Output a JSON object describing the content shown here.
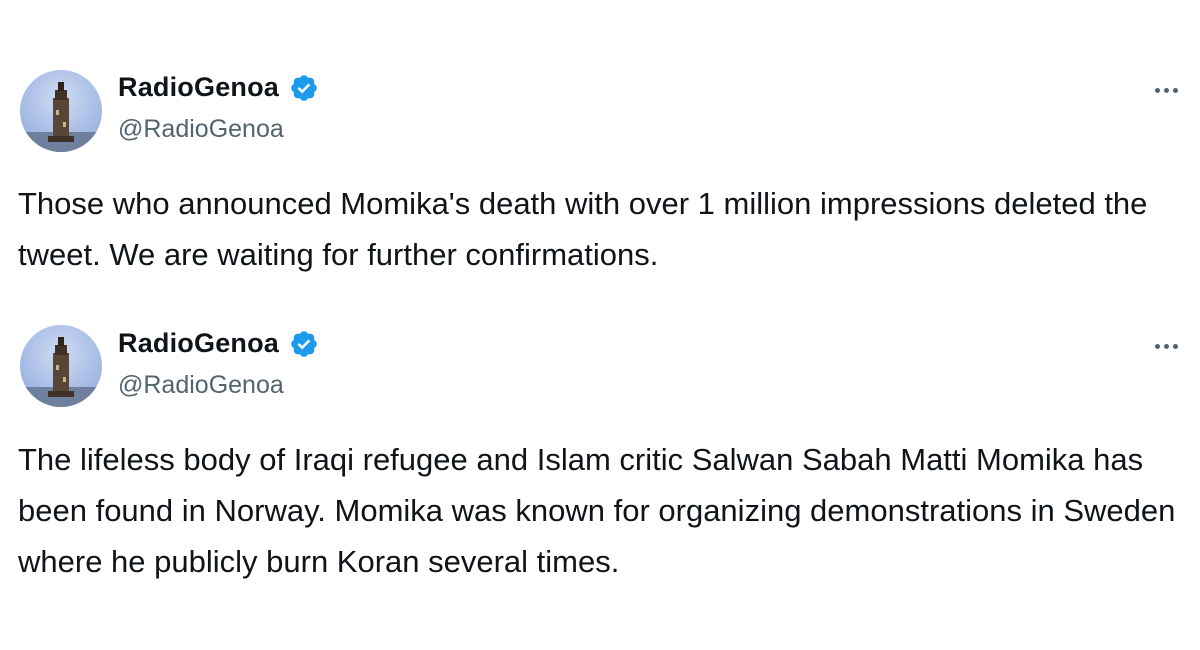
{
  "tweets": [
    {
      "display_name": "RadioGenoa",
      "handle": "@RadioGenoa",
      "verified": true,
      "verified_color": "#1d9bf0",
      "avatar_icon": "lighthouse-avatar",
      "more_icon": "more-options-icon",
      "text": "Those who announced Momika's death with over 1 million impressions deleted the tweet. We are waiting for further confirmations."
    },
    {
      "display_name": "RadioGenoa",
      "handle": "@RadioGenoa",
      "verified": true,
      "verified_color": "#1d9bf0",
      "avatar_icon": "lighthouse-avatar",
      "more_icon": "more-options-icon",
      "text": "The lifeless body of Iraqi refugee and Islam critic Salwan Sabah Matti Momika has been found in Norway. Momika was known for organizing demonstrations in Sweden where he publicly burn Koran several times."
    }
  ]
}
